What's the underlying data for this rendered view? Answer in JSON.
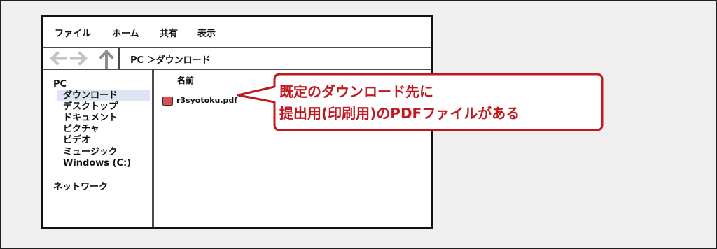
{
  "menubar": {
    "items": [
      "ファイル",
      "ホーム",
      "共有",
      "表示"
    ]
  },
  "addressbar": {
    "path": "PC ＞ダウンロード",
    "icons": [
      "back-arrow-icon",
      "forward-arrow-icon",
      "up-arrow-icon"
    ]
  },
  "sidebar": {
    "root": "PC",
    "items": [
      "ダウンロード",
      "デスクトップ",
      "ドキュメント",
      "ピクチャ",
      "ビデオ",
      "ミュージック",
      "Windows (C:)"
    ],
    "selected": "ダウンロード",
    "network": "ネットワーク"
  },
  "content": {
    "column_header": "名前",
    "files": [
      {
        "name": "r3syotoku.pdf",
        "icon": "pdf-file-icon"
      }
    ]
  },
  "callout": {
    "line1": "既定のダウンロード先に",
    "line2": "提出用(印刷用)のPDFファイルがある"
  },
  "colors": {
    "accent": "#c0181e",
    "pdf_icon": "#d94f57",
    "selection": "#dde4f2",
    "background": "#efefef"
  }
}
